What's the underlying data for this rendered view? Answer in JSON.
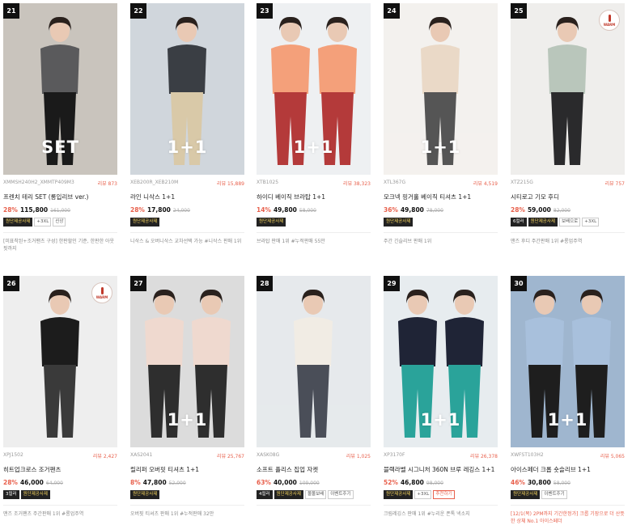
{
  "products": [
    {
      "rank": "21",
      "overlay": "SET",
      "warm": false,
      "code": "XMMSH240H2_XMMTP409M3",
      "review": "리뷰 873",
      "name": "프렌치 테리 SET (롱입리브 ver.)",
      "discount": "28%",
      "price": "115,800",
      "orig": "161,000",
      "badges": [
        {
          "text": "원단제공사제",
          "style": "dark"
        },
        {
          "text": "+3XL",
          "style": "plain"
        },
        {
          "text": "신상",
          "style": "plain"
        }
      ],
      "desc": "[미표착된+조거팬츠 구성] 한판할인 기준, 한판한 아웃핏까지",
      "desc_red": false,
      "colors": [
        "#c9c4bd",
        "#5a5a5c",
        "#1a1a1a"
      ]
    },
    {
      "rank": "22",
      "overlay": "1+1",
      "warm": false,
      "code": "XEB200R_XEB210M",
      "review": "리뷰 15,889",
      "name": "라인 니삭스 1+1",
      "discount": "28%",
      "price": "17,800",
      "orig": "24,000",
      "badges": [
        {
          "text": "원단제공사제",
          "style": "dark"
        }
      ],
      "desc": "니삭스 & 오버니삭스 교차선택 가능 #니삭스 판매 1위",
      "desc_red": false,
      "colors": [
        "#d0d6dc",
        "#3a3e44",
        "#d9c9a8"
      ]
    },
    {
      "rank": "23",
      "overlay": "1+1",
      "warm": false,
      "code": "XTB1025",
      "review": "리뷰 38,323",
      "name": "하이디 베이직 브라탑 1+1",
      "discount": "14%",
      "price": "49,800",
      "orig": "58,000",
      "badges": [
        {
          "text": "원단제공사제",
          "style": "dark"
        }
      ],
      "desc": "브라탑 판매 1위 #누적판매 55만",
      "desc_red": false,
      "colors": [
        "#eef0f2",
        "#f4a07a",
        "#b43a3a"
      ]
    },
    {
      "rank": "24",
      "overlay": "1+1",
      "warm": false,
      "code": "XTL367G",
      "review": "리뷰 4,519",
      "name": "모크넥 핑거홀 베이직 티셔츠 1+1",
      "discount": "36%",
      "price": "49,800",
      "orig": "78,000",
      "badges": [
        {
          "text": "원단제공사제",
          "style": "dark"
        }
      ],
      "desc": "주간 긴슬리브 판매 1위",
      "desc_red": false,
      "colors": [
        "#f3f1ee",
        "#ead9c7",
        "#555555"
      ]
    },
    {
      "rank": "25",
      "overlay": "",
      "warm": true,
      "code": "XTZ215G",
      "review": "리뷰 757",
      "name": "시티로고 기모 후디",
      "discount": "28%",
      "price": "59,000",
      "orig": "82,000",
      "badges": [
        {
          "text": "6컬러",
          "style": "blk"
        },
        {
          "text": "원단제공사제",
          "style": "dark"
        },
        {
          "text": "보배으로",
          "style": "plain"
        },
        {
          "text": "+3XL",
          "style": "plain"
        }
      ],
      "desc": "맨즈 후디 주간판매 1위 #롱업주역",
      "desc_red": false,
      "colors": [
        "#efeeec",
        "#b9c6bb",
        "#2a2a2c"
      ]
    },
    {
      "rank": "26",
      "overlay": "",
      "warm": true,
      "code": "XPJ1502",
      "review": "리뷰 2,427",
      "name": "히트업크로스 조거팬츠",
      "discount": "28%",
      "price": "46,000",
      "orig": "64,000",
      "badges": [
        {
          "text": "3컬러",
          "style": "blk"
        },
        {
          "text": "원단제공사제",
          "style": "dark"
        }
      ],
      "desc": "맨즈 조거팬츠 주간판매 1위 #롱업주역",
      "desc_red": false,
      "colors": [
        "#eeeeee",
        "#1c1c1c",
        "#3a3a3a"
      ]
    },
    {
      "rank": "27",
      "overlay": "1+1",
      "warm": false,
      "code": "XAS2041",
      "review": "리뷰 25,767",
      "name": "릴리퍼 오버핏 티셔츠 1+1",
      "discount": "8%",
      "price": "47,800",
      "orig": "52,000",
      "badges": [
        {
          "text": "원단제공사제",
          "style": "dark"
        }
      ],
      "desc": "오버핏 티셔츠 판매 1위 #누적판매 32만",
      "desc_red": false,
      "colors": [
        "#dcdcdc",
        "#efd9cf",
        "#2e2e2e"
      ]
    },
    {
      "rank": "28",
      "overlay": "",
      "warm": false,
      "code": "XASK08G",
      "review": "리뷰 1,025",
      "name": "소프트 플리스 집업 자켓",
      "discount": "63%",
      "price": "40,000",
      "orig": "109,000",
      "badges": [
        {
          "text": "4컬러",
          "style": "blk"
        },
        {
          "text": "원단제공사제",
          "style": "dark"
        },
        {
          "text": "몰몰보배",
          "style": "plain"
        },
        {
          "text": "이벤트주기",
          "style": "plain"
        }
      ],
      "desc": "",
      "desc_red": false,
      "colors": [
        "#e6e9ec",
        "#f1ece4",
        "#4a4e58"
      ]
    },
    {
      "rank": "29",
      "overlay": "1+1",
      "warm": false,
      "code": "XP3170F",
      "review": "리뷰 26,378",
      "name": "블랙라벨 시그니처 360N 브루 레깅스 1+1",
      "discount": "52%",
      "price": "46,800",
      "orig": "98,000",
      "badges": [
        {
          "text": "원단제공사제",
          "style": "dark"
        },
        {
          "text": "+3XL",
          "style": "plain"
        },
        {
          "text": "추천하기",
          "style": "pink"
        }
      ],
      "desc": "크림레깅스 판매 1위 #누리운 폰톡 넥소지",
      "desc_red": false,
      "colors": [
        "#e7ecef",
        "#1f2436",
        "#2aa39a"
      ]
    },
    {
      "rank": "30",
      "overlay": "1+1",
      "warm": false,
      "code": "XWFST103H2",
      "review": "리뷰 5,065",
      "name": "아이스페더 크롭 숏슬리브 1+1",
      "discount": "46%",
      "price": "30,800",
      "orig": "58,000",
      "badges": [
        {
          "text": "원단제공사제",
          "style": "dark"
        },
        {
          "text": "이벤트주기",
          "style": "plain"
        }
      ],
      "desc": "[12/1(목) 2PM까지 기간한정가] 크롭 기장으로 더 산뜻한 상체 No.1 아이스페더",
      "desc_red": true,
      "colors": [
        "#9fb6cf",
        "#a8c0dc",
        "#1e1e1e"
      ]
    }
  ]
}
